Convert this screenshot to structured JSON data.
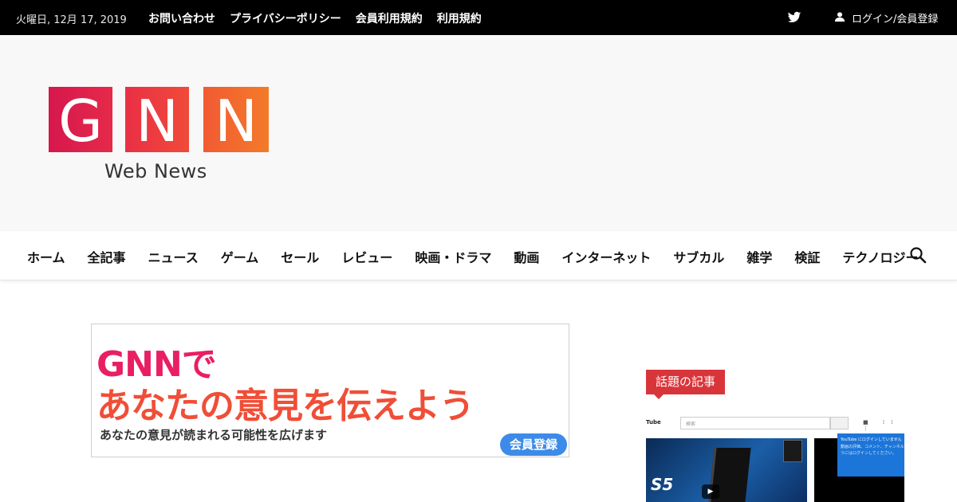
{
  "topbar": {
    "date": "火曜日, 12月 17, 2019",
    "links": [
      "お問い合わせ",
      "プライバシーポリシー",
      "会員利用規約",
      "利用規約"
    ],
    "login": "ログイン/会員登録"
  },
  "logo": {
    "letters": [
      "G",
      "N",
      "N"
    ],
    "subtitle": "Web News"
  },
  "nav": {
    "items": [
      "ホーム",
      "全記事",
      "ニュース",
      "ゲーム",
      "セール",
      "レビュー",
      "映画・ドラマ",
      "動画",
      "インターネット",
      "サブカル",
      "雑学",
      "検証",
      "テクノロジー"
    ]
  },
  "banner": {
    "line1": "GNNで",
    "line2": "あなたの意見を伝えよう",
    "line3": "あなたの意見が読まれる可能性を広げます",
    "button": "会員登録"
  },
  "sidebar": {
    "widget_title": "話題の記事",
    "thumb": {
      "yt_logo": "Tube",
      "yt_search_placeholder": "検索",
      "video_text": "S5",
      "popup_line1": "YouTube にログインしていません",
      "popup_line2": "動画の評価、コメント、チャンネル",
      "popup_line3": "うにはログインしてください。"
    }
  },
  "colors": {
    "topbar_bg": "#000000",
    "header_bg": "#f8f8f8",
    "logo_gradient": [
      "#d6174d",
      "#f06e2a"
    ],
    "widget_title_bg": "#d8353a",
    "banner_button": "#3d8be8"
  },
  "icons": [
    "twitter-icon",
    "user-icon",
    "search-icon",
    "play-icon"
  ]
}
